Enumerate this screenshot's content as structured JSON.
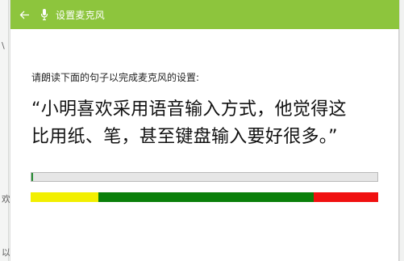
{
  "window": {
    "title": "设置麦克风"
  },
  "dialog": {
    "instruction": "请朗读下面的句子以完成麦克风的设置:",
    "quote_line1": "“小明喜欢采用语音输入方式，他觉得这",
    "quote_line2": "比用纸、笔，甚至键盘输入要好很多。”"
  },
  "background_window": {
    "ghost_chars": [
      "\\",
      "欢",
      "以"
    ]
  },
  "progress": {
    "value_fraction": 0.004,
    "fill_color": "#2a8f36",
    "track_color": "#e6e6e6"
  },
  "level_meter": {
    "segments": [
      {
        "name": "low",
        "fraction": 0.195,
        "color": "#f2ef00"
      },
      {
        "name": "mid",
        "fraction": 0.62,
        "color": "#0a7f0a"
      },
      {
        "name": "high",
        "fraction": 0.185,
        "color": "#f01010"
      }
    ]
  },
  "icons": {
    "back": "back-arrow-icon",
    "mic": "microphone-icon"
  },
  "colors": {
    "titlebar": "#8dc53d",
    "title_text": "#ffffff"
  }
}
